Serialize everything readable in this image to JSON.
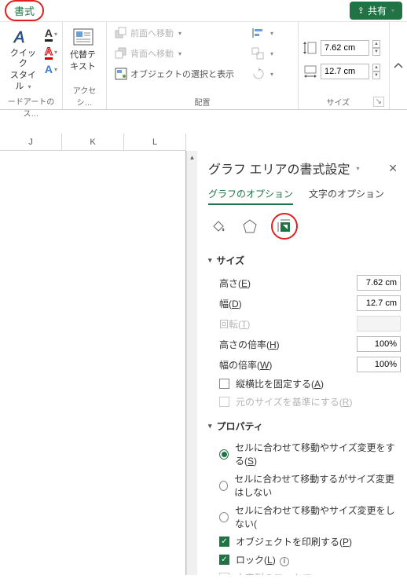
{
  "titlebar": {
    "format_tab": "書式",
    "share": "共有"
  },
  "ribbon": {
    "wordart": {
      "label1": "クイック",
      "label2": "スタイル",
      "group": "ードアートのス…"
    },
    "alttext": {
      "label1": "代替テ",
      "label2": "キスト",
      "group": "アクセシ…"
    },
    "arrange": {
      "bring_forward": "前面へ移動",
      "send_backward": "背面へ移動",
      "selection_pane": "オブジェクトの選択と表示",
      "group": "配置"
    },
    "size": {
      "height": "7.62 cm",
      "width": "12.7 cm",
      "group": "サイズ"
    }
  },
  "columns": [
    "J",
    "K",
    "L"
  ],
  "pane": {
    "title": "グラフ エリアの書式設定",
    "tabs": {
      "chart": "グラフのオプション",
      "text": "文字のオプション"
    },
    "size_section": {
      "title": "サイズ",
      "height_label": "高さ(E)",
      "height_val": "7.62 cm",
      "width_label": "幅(D)",
      "width_val": "12.7 cm",
      "rotation_label": "回転(T)",
      "scale_h_label": "高さの倍率(H)",
      "scale_h_val": "100%",
      "scale_w_label": "幅の倍率(W)",
      "scale_w_val": "100%",
      "lock_aspect": "縦横比を固定する(A)",
      "orig_size": "元のサイズを基準にする(R)"
    },
    "prop_section": {
      "title": "プロパティ",
      "move_size": "セルに合わせて移動やサイズ変更をする(S)",
      "move_only": "セルに合わせて移動するがサイズ変更はしない",
      "none": "セルに合わせて移動やサイズ変更をしない(",
      "print": "オブジェクトを印刷する(P)",
      "lock": "ロック(L)",
      "lock_text": "文字列のロック(T)"
    }
  }
}
